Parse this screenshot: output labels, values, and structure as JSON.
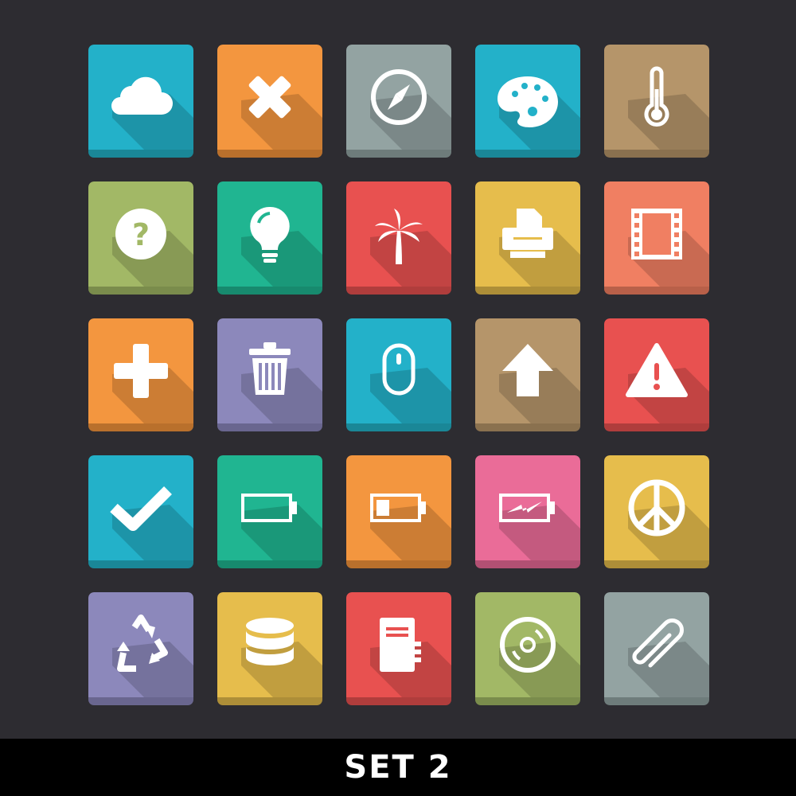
{
  "footer": {
    "title": "SET 2"
  },
  "colors": {
    "background": "#2d2c31",
    "footer": "#000000",
    "glyph": "#ffffff"
  },
  "tiles": [
    {
      "icon": "cloud-icon",
      "color": "#23b1c9",
      "base": "#1a8797"
    },
    {
      "icon": "close-icon",
      "color": "#f3963f",
      "base": "#b9702c"
    },
    {
      "icon": "compass-icon",
      "color": "#93a3a2",
      "base": "#6e7c7b"
    },
    {
      "icon": "palette-icon",
      "color": "#23b1c9",
      "base": "#1a8797"
    },
    {
      "icon": "thermometer-icon",
      "color": "#b5956a",
      "base": "#8a714f"
    },
    {
      "icon": "help-icon",
      "color": "#a2b866",
      "base": "#7a8c4c"
    },
    {
      "icon": "lightbulb-icon",
      "color": "#20b591",
      "base": "#178a6e"
    },
    {
      "icon": "palm-tree-icon",
      "color": "#e85150",
      "base": "#b03d3c"
    },
    {
      "icon": "printer-icon",
      "color": "#e6bd4c",
      "base": "#ad8e38"
    },
    {
      "icon": "film-icon",
      "color": "#f07f62",
      "base": "#b86049"
    },
    {
      "icon": "plus-icon",
      "color": "#f3963f",
      "base": "#b9702c"
    },
    {
      "icon": "trash-icon",
      "color": "#8c88bb",
      "base": "#69668f"
    },
    {
      "icon": "mouse-icon",
      "color": "#23b1c9",
      "base": "#1a8797"
    },
    {
      "icon": "arrow-up-icon",
      "color": "#b5956a",
      "base": "#8a714f"
    },
    {
      "icon": "warning-icon",
      "color": "#e85150",
      "base": "#b03d3c"
    },
    {
      "icon": "checkmark-icon",
      "color": "#23b1c9",
      "base": "#1a8797"
    },
    {
      "icon": "battery-empty-icon",
      "color": "#20b591",
      "base": "#178a6e"
    },
    {
      "icon": "battery-low-icon",
      "color": "#f3963f",
      "base": "#b9702c"
    },
    {
      "icon": "battery-charging-icon",
      "color": "#ea6c98",
      "base": "#b25073"
    },
    {
      "icon": "peace-icon",
      "color": "#e6bd4c",
      "base": "#ad8e38"
    },
    {
      "icon": "recycle-icon",
      "color": "#8c88bb",
      "base": "#69668f"
    },
    {
      "icon": "database-icon",
      "color": "#e6bd4c",
      "base": "#ad8e38"
    },
    {
      "icon": "notebook-icon",
      "color": "#e85150",
      "base": "#b03d3c"
    },
    {
      "icon": "disc-icon",
      "color": "#a2b866",
      "base": "#7a8c4c"
    },
    {
      "icon": "paperclip-icon",
      "color": "#93a3a2",
      "base": "#6e7c7b"
    }
  ]
}
